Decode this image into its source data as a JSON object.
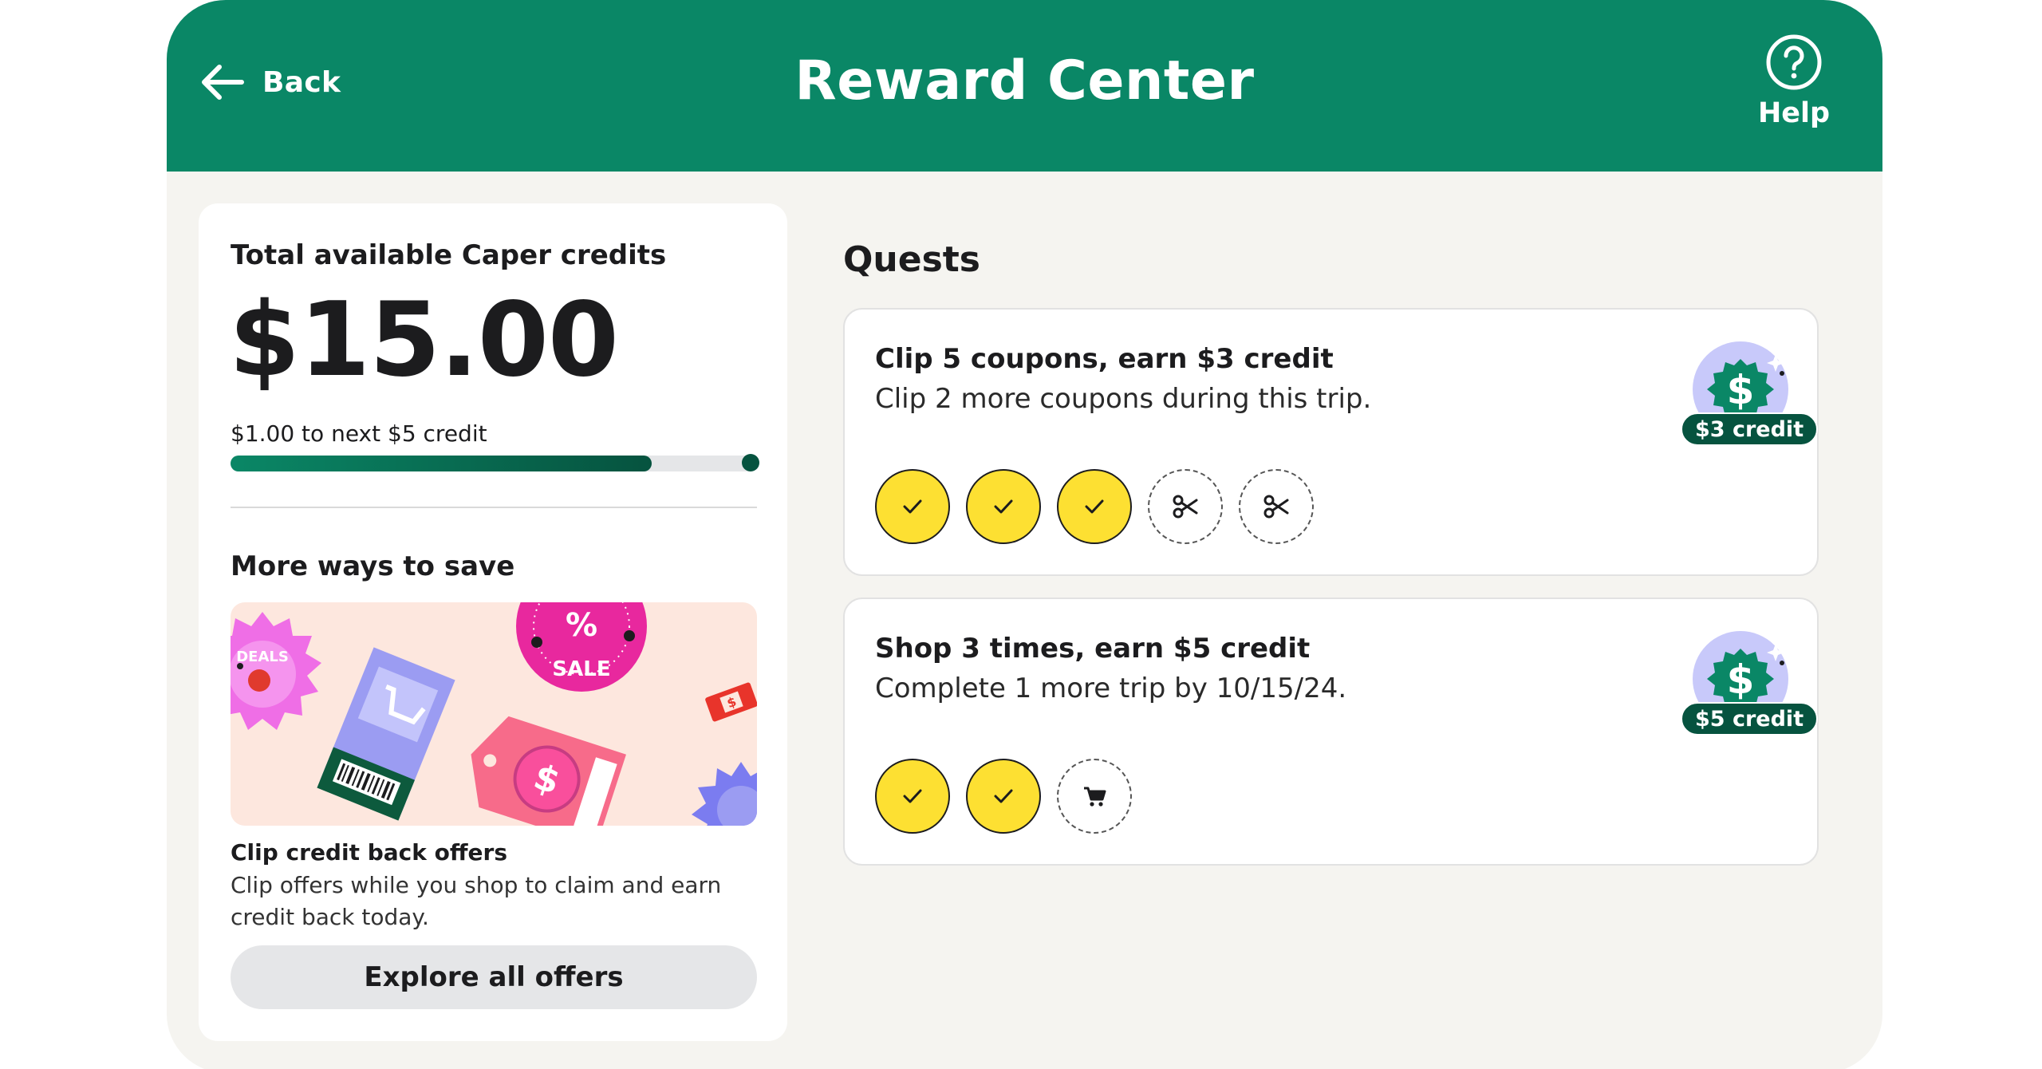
{
  "header": {
    "back_label": "Back",
    "title": "Reward Center",
    "help_label": "Help",
    "color": "#0a8766"
  },
  "credits": {
    "title": "Total available Caper credits",
    "amount": "$15.00",
    "next_text": "$1.00 to next $5 credit",
    "progress_fraction": 0.8
  },
  "more_ways": {
    "heading": "More ways to save",
    "offer_title": "Clip credit back offers",
    "offer_desc": "Clip offers while you shop to claim and earn credit back today.",
    "explore_button": "Explore all offers",
    "banner_text": {
      "deals": "DEALS",
      "sale": "SALE",
      "percent": "%"
    }
  },
  "quests": {
    "heading": "Quests",
    "items": [
      {
        "name": "Clip 5 coupons, earn $3 credit",
        "desc": "Clip 2 more coupons during this trip.",
        "badge": "$3 credit",
        "steps": [
          {
            "done": true,
            "icon": "check-icon"
          },
          {
            "done": true,
            "icon": "check-icon"
          },
          {
            "done": true,
            "icon": "check-icon"
          },
          {
            "done": false,
            "icon": "scissors-icon"
          },
          {
            "done": false,
            "icon": "scissors-icon"
          }
        ]
      },
      {
        "name": "Shop 3 times, earn $5 credit",
        "desc": "Complete 1 more trip by 10/15/24.",
        "badge": "$5 credit",
        "steps": [
          {
            "done": true,
            "icon": "check-icon"
          },
          {
            "done": true,
            "icon": "check-icon"
          },
          {
            "done": false,
            "icon": "cart-icon"
          }
        ]
      }
    ]
  },
  "colors": {
    "brand_green": "#0a8766",
    "dark_green": "#06533f",
    "step_done": "#fde032",
    "background": "#f5f4f0"
  }
}
